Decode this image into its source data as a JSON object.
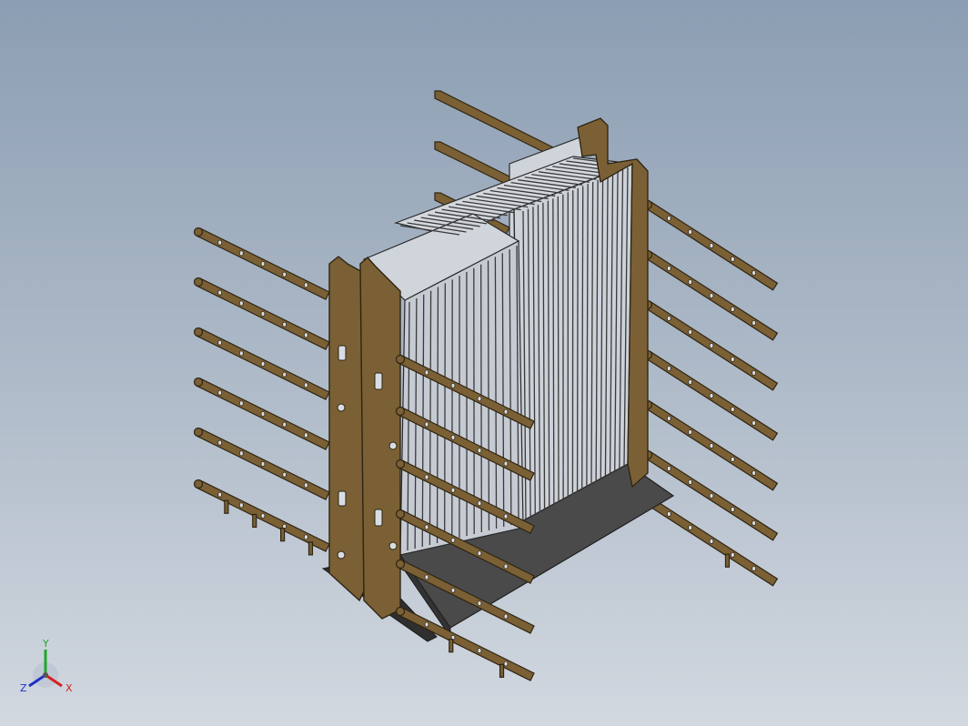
{
  "viewport": {
    "background_top": "#8c9eb3",
    "background_bottom": "#d2d8e0"
  },
  "model": {
    "frame_color": "#7a6034",
    "frame_edge": "#2e2414",
    "tray_color": "#4a4a4a",
    "grille_color": "#c9ced6",
    "grille_line": "#3a3a3a"
  },
  "triad": {
    "y_label": "Y",
    "z_label": "Z",
    "x_label": "X",
    "x_color": "#d62020",
    "y_color": "#1fa82a",
    "z_color": "#2030c8"
  }
}
